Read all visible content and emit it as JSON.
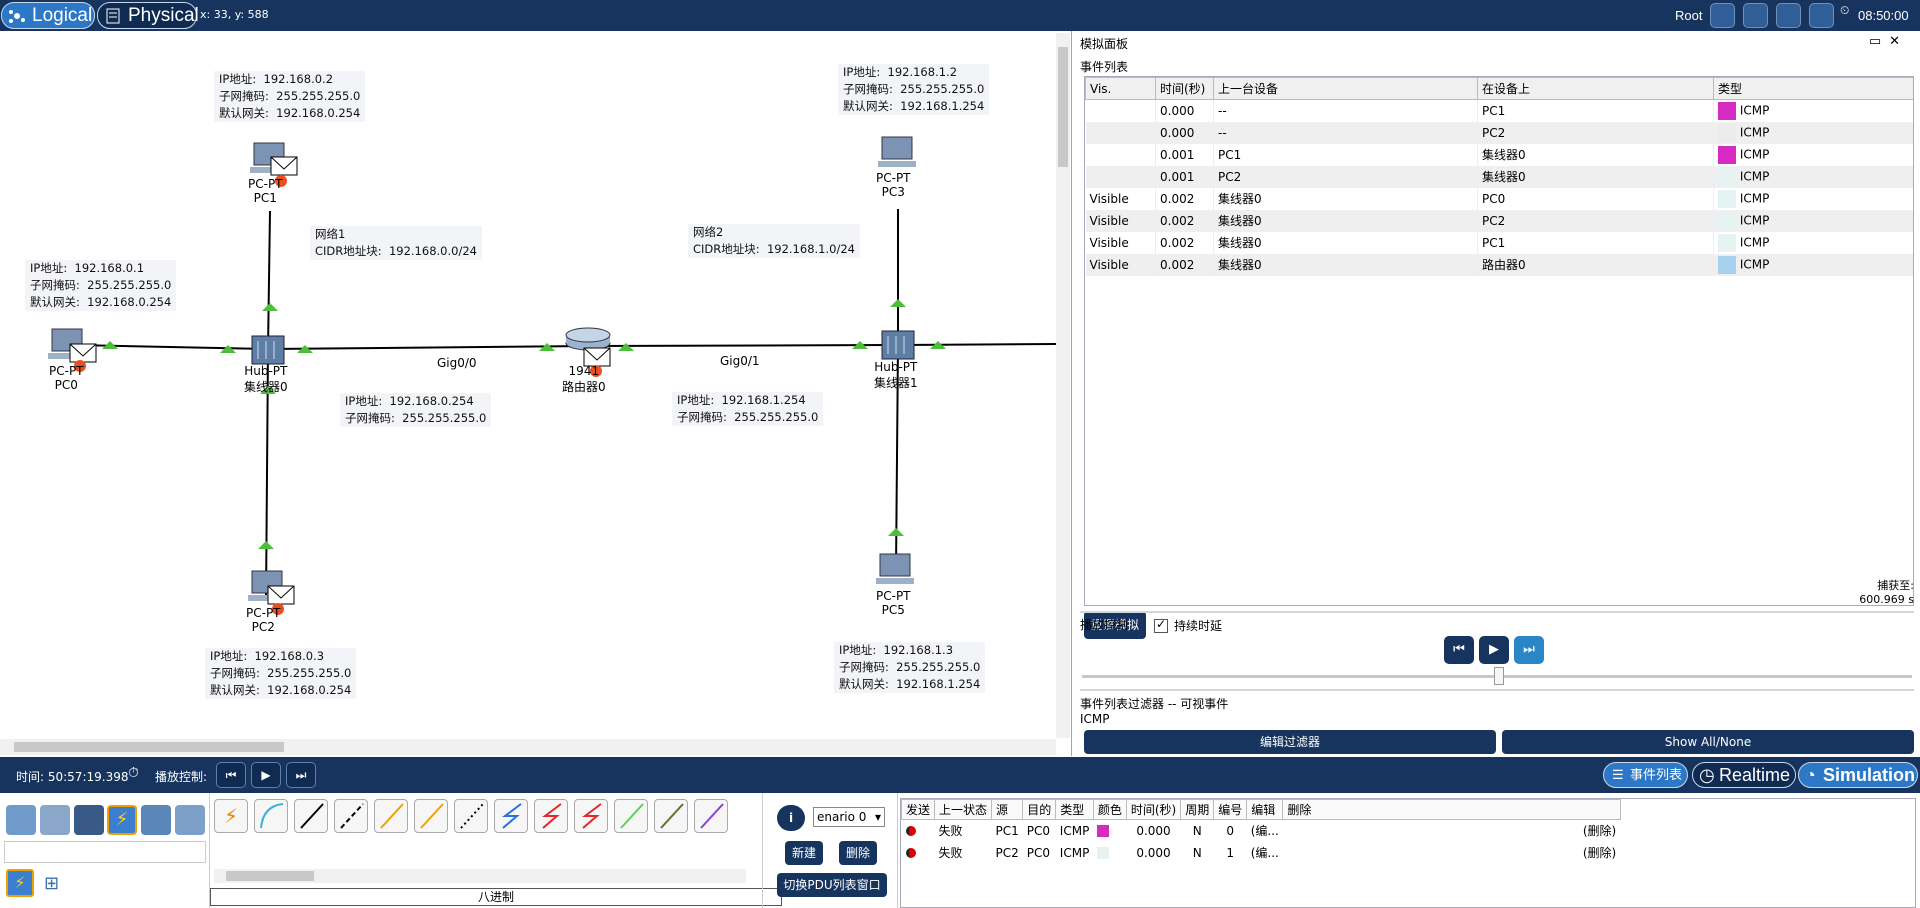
{
  "topbar": {
    "logical_label": "Logical",
    "physical_label": "Physical",
    "coords": "x: 33, y: 588",
    "user_label": "Root",
    "clock": "08:50:00"
  },
  "workspace": {
    "info_boxes": {
      "pc1": "IP地址:  192.168.0.2\n子网掩码:  255.255.255.0\n默认网关:  192.168.0.254",
      "pc3": "IP地址:  192.168.1.2\n子网掩码:  255.255.255.0\n默认网关:  192.168.1.254",
      "pc0": "IP地址:  192.168.0.1\n子网掩码:  255.255.255.0\n默认网关:  192.168.0.254",
      "net1": "网络1\nCIDR地址块:  192.168.0.0/24",
      "net2": "网络2\nCIDR地址块:  192.168.1.0/24",
      "gig00": "IP地址:  192.168.0.254\n子网掩码:  255.255.255.0",
      "gig01": "IP地址:  192.168.1.254\n子网掩码:  255.255.255.0",
      "pc2": "IP地址:  192.168.0.3\n子网掩码:  255.255.255.0\n默认网关:  192.168.0.254",
      "pc5": "IP地址:  192.168.1.3\n子网掩码:  255.255.255.0\n默认网关:  192.168.1.254"
    },
    "devices": {
      "pc1": "PC-PT\nPC1",
      "pc3": "PC-PT\nPC3",
      "pc0": "PC-PT\nPC0",
      "hub0": "Hub-PT\n集线器0",
      "router0": "1941\n路由器0",
      "hub1": "Hub-PT\n集线器1",
      "pc2": "PC-PT\nPC2",
      "pc5": "PC-PT\nPC5"
    },
    "links": {
      "gig00": "Gig0/0",
      "gig01": "Gig0/1"
    }
  },
  "sim_panel": {
    "title": "模拟面板",
    "event_list_label": "事件列表",
    "columns": [
      "Vis.",
      "时间(秒)",
      "上一台设备",
      "在设备上",
      "类型"
    ],
    "events": [
      {
        "vis": "",
        "time": "0.000",
        "last": "--",
        "at": "PC1",
        "color": "#d62bc3",
        "type": "ICMP"
      },
      {
        "vis": "",
        "time": "0.000",
        "last": "--",
        "at": "PC2",
        "color": "#ececec",
        "type": "ICMP"
      },
      {
        "vis": "",
        "time": "0.001",
        "last": "PC1",
        "at": "集线器0",
        "color": "#d62bc3",
        "type": "ICMP"
      },
      {
        "vis": "",
        "time": "0.001",
        "last": "PC2",
        "at": "集线器0",
        "color": "#e6f3f3",
        "type": "ICMP"
      },
      {
        "vis": "Visible",
        "time": "0.002",
        "last": "集线器0",
        "at": "PC0",
        "color": "#e6f3f3",
        "type": "ICMP"
      },
      {
        "vis": "Visible",
        "time": "0.002",
        "last": "集线器0",
        "at": "PC2",
        "color": "#e6f3f3",
        "type": "ICMP"
      },
      {
        "vis": "Visible",
        "time": "0.002",
        "last": "集线器0",
        "at": "PC1",
        "color": "#e6f3f3",
        "type": "ICMP"
      },
      {
        "vis": "Visible",
        "time": "0.002",
        "last": "集线器0",
        "at": "路由器0",
        "color": "#a8d0ef",
        "type": "ICMP"
      }
    ],
    "reset_label": "重置模拟",
    "persist_label": "持续时延",
    "capture_label": "捕获至:",
    "capture_value": "600.969 s",
    "play_label": "播放控制",
    "filter_title": "事件列表过滤器 -- 可视事件",
    "filter_value": "ICMP",
    "edit_filter_label": "编辑过滤器",
    "show_all_label": "Show All/None"
  },
  "strip": {
    "time": "时间: 50:57:19.398",
    "play_label": "播放控制:",
    "event_list_btn": "事件列表",
    "realtime_btn": "Realtime",
    "simulation_btn": "Simulation"
  },
  "bottom": {
    "tray_label": "八进制",
    "scenario": "enario 0",
    "new_label": "新建",
    "delete_label": "删除",
    "toggle_label": "切换PDU列表窗口",
    "pdu_columns": [
      "发送",
      "上一状态",
      "源",
      "目的",
      "类型",
      "颜色",
      "时间(秒)",
      "周期",
      "编号",
      "编辑",
      "删除"
    ],
    "pdu_rows": [
      {
        "status": "失败",
        "src": "PC1",
        "dst": "PC0",
        "type": "ICMP",
        "color": "#d62bc3",
        "time": "0.000",
        "period": "N",
        "num": "0",
        "edit": "(编...",
        "del": "(删除)"
      },
      {
        "status": "失败",
        "src": "PC2",
        "dst": "PC0",
        "type": "ICMP",
        "color": "#e6f3f3",
        "time": "0.000",
        "period": "N",
        "num": "1",
        "edit": "(编...",
        "del": "(删除)"
      }
    ]
  }
}
